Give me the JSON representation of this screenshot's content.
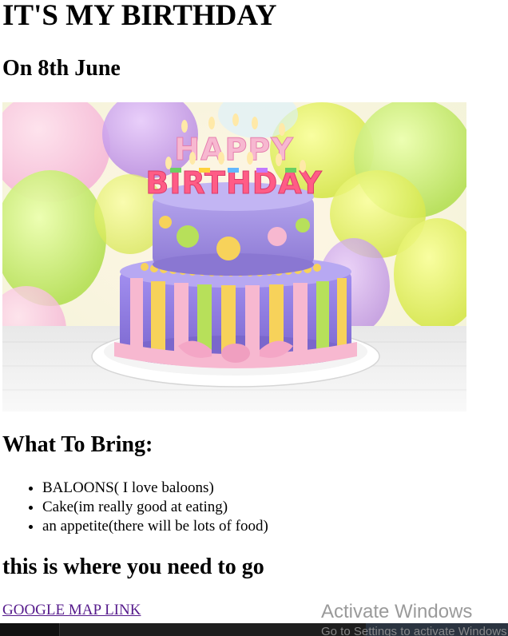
{
  "page": {
    "title": "IT'S MY BIRTHDAY",
    "date_heading": "On 8th June",
    "image": {
      "candles_text": "HAPPY BIRTHDAY"
    },
    "bring_heading": "What To Bring:",
    "bring_items": [
      "BALOONS( I love baloons)",
      "Cake(im really good at eating)",
      "an appetite(there will be lots of food)"
    ],
    "where_heading": "this is where you need to go",
    "map_link": "GOOGLE MAP LINK"
  },
  "overlay": {
    "activate_title": "Activate Windows",
    "activate_sub": "Go to Settings to activate Windows."
  },
  "colors": {
    "link_visited": "#551a8b",
    "cake_top": "#9a86d8",
    "cake_bottom": "#8f7be0",
    "ribbon_pink": "#f7b8d0"
  }
}
